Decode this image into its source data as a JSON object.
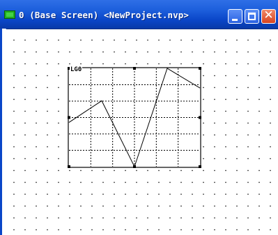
{
  "window": {
    "title": "0 (Base Screen) <NewProject.nvp>",
    "icon": "screen-icon",
    "controls": [
      "minimize-icon",
      "maximize-icon",
      "close-icon"
    ]
  },
  "graph_object": {
    "label": "LG0",
    "grid_columns": 6,
    "grid_rows": 6,
    "line_color": "#000000"
  },
  "chart_data": {
    "type": "line",
    "series": [
      {
        "values": [
          0.45,
          0.67,
          0.0,
          1.0,
          0.8
        ]
      }
    ],
    "ylim": [
      0,
      1
    ],
    "grid": true
  },
  "colors": {
    "titlebar": "#0a46c8",
    "close_button": "#d8431f",
    "canvas_background": "#ffffff"
  }
}
